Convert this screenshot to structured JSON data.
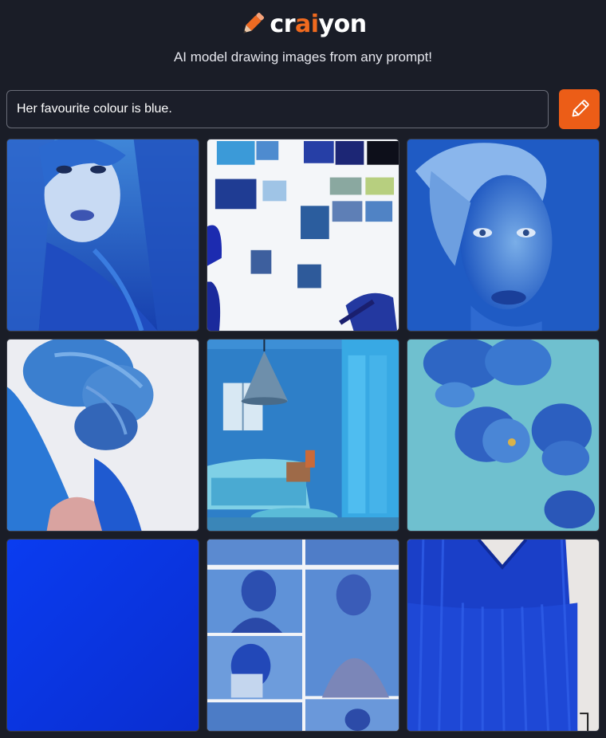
{
  "brand": {
    "pre": "cr",
    "accent": "ai",
    "post": "yon",
    "accent_color": "#f06a1f"
  },
  "tagline": "AI model drawing images from any prompt!",
  "prompt": {
    "value": "Her favourite colour is blue.",
    "placeholder": ""
  },
  "draw_button": {
    "icon": "pencil-icon",
    "color": "#ec5d17"
  },
  "images": [
    {
      "name": "blue-hair-woman-face"
    },
    {
      "name": "blue-swatches-wall"
    },
    {
      "name": "blue-woman-portrait"
    },
    {
      "name": "blue-braided-bun"
    },
    {
      "name": "blue-living-room"
    },
    {
      "name": "blue-fluffy-flowers"
    },
    {
      "name": "solid-blue-square"
    },
    {
      "name": "blue-fashion-collage"
    },
    {
      "name": "blue-pleated-dress"
    }
  ]
}
